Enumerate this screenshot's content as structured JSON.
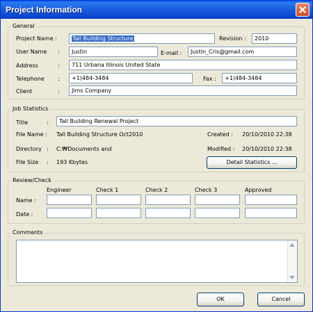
{
  "window": {
    "title": "Project Information"
  },
  "general": {
    "legend": "General",
    "project_name": {
      "label": "Project Name :",
      "value": "Tall Building Structure"
    },
    "revision": {
      "label": "Revision :",
      "value": "2010"
    },
    "user_name": {
      "label": "User Name",
      "colon": ":",
      "value": "Justin"
    },
    "email": {
      "label": "E-mail :",
      "value": "Justin_Cris@gmail.com"
    },
    "address": {
      "label": "Address",
      "colon": ":",
      "value": "711 Urbana Illinois United State"
    },
    "telephone": {
      "label": "Telephone",
      "colon": ":",
      "value": "+1)484-3484"
    },
    "fax": {
      "label": "Fax :",
      "value": "+1)484-3484"
    },
    "client": {
      "label": "Client",
      "colon": ":",
      "value": "Jims Company"
    }
  },
  "job": {
    "legend": "Job Statistics",
    "title": {
      "label": "Title",
      "colon": ":",
      "value": "Tall Building Renewal Project"
    },
    "file_name": {
      "label": "File Name :",
      "value": "Tall Building Structure  Oct2010"
    },
    "directory": {
      "label": "Directory",
      "colon": ":",
      "value": "C:₩Documents and"
    },
    "file_size": {
      "label": "File Size",
      "colon": ":",
      "value": "193 Kbytes"
    },
    "created": {
      "label": "Created :",
      "value": "20/10/2010  22:38"
    },
    "modified": {
      "label": "Modified :",
      "value": "20/10/2010  22:38"
    },
    "detail_button": "Detail Statistics ..."
  },
  "review": {
    "legend": "Review/Check",
    "columns": [
      "Engineer",
      "Check 1",
      "Check 2",
      "Check 3",
      "Approved"
    ],
    "name_label": "Name :",
    "date_label": "Date :"
  },
  "comments": {
    "legend": "Comments",
    "value": ""
  },
  "buttons": {
    "ok": "OK",
    "cancel": "Cancel"
  }
}
